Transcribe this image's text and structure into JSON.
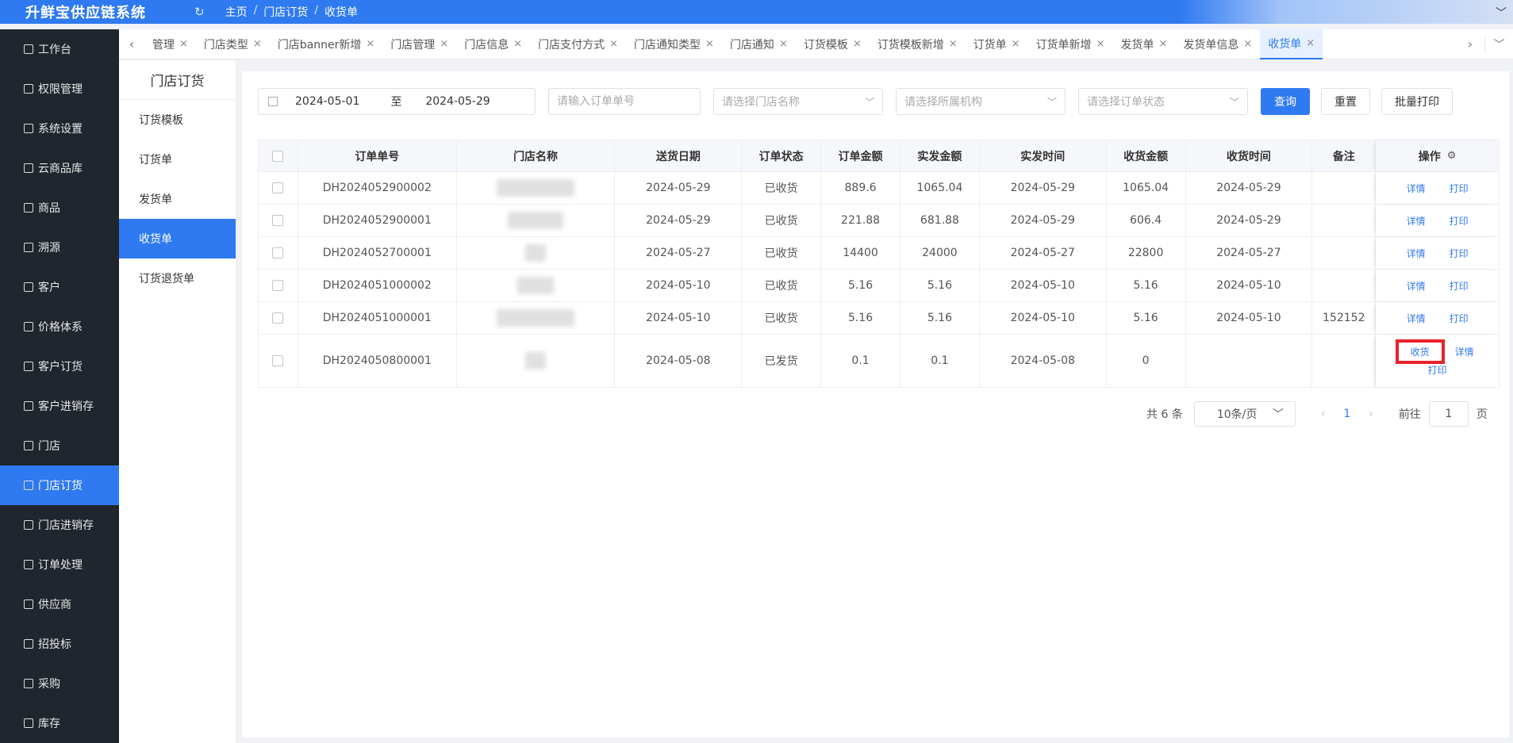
{
  "app": {
    "title": "升鲜宝供应链系统",
    "refresh_icon": "refresh-icon"
  },
  "breadcrumb": [
    "主页",
    "门店订货",
    "收货单"
  ],
  "sidebar": {
    "items": [
      {
        "label": "工作台",
        "icon": "monitor-icon"
      },
      {
        "label": "权限管理",
        "icon": "shield-icon"
      },
      {
        "label": "系统设置",
        "icon": "gear-icon"
      },
      {
        "label": "云商品库",
        "icon": "cloud-icon"
      },
      {
        "label": "商品",
        "icon": "box-icon"
      },
      {
        "label": "溯源",
        "icon": "trace-icon"
      },
      {
        "label": "客户",
        "icon": "user-icon"
      },
      {
        "label": "价格体系",
        "icon": "price-icon"
      },
      {
        "label": "客户订货",
        "icon": "doc-icon"
      },
      {
        "label": "客户进销存",
        "icon": "bank-icon"
      },
      {
        "label": "门店",
        "icon": "store-icon"
      },
      {
        "label": "门店订货",
        "icon": "user-icon",
        "active": true
      },
      {
        "label": "门店进销存",
        "icon": "inventory-icon"
      },
      {
        "label": "订单处理",
        "icon": "send-icon"
      },
      {
        "label": "供应商",
        "icon": "supplier-icon"
      },
      {
        "label": "招投标",
        "icon": "bid-icon"
      },
      {
        "label": "采购",
        "icon": "purchase-icon"
      },
      {
        "label": "库存",
        "icon": "stock-icon"
      }
    ]
  },
  "tabs": [
    {
      "label": "管理"
    },
    {
      "label": "门店类型"
    },
    {
      "label": "门店banner新增"
    },
    {
      "label": "门店管理"
    },
    {
      "label": "门店信息"
    },
    {
      "label": "门店支付方式"
    },
    {
      "label": "门店通知类型"
    },
    {
      "label": "门店通知"
    },
    {
      "label": "订货模板"
    },
    {
      "label": "订货模板新增"
    },
    {
      "label": "订货单"
    },
    {
      "label": "订货单新增"
    },
    {
      "label": "发货单"
    },
    {
      "label": "发货单信息"
    },
    {
      "label": "收货单",
      "active": true
    }
  ],
  "subnav": {
    "title": "门店订货",
    "items": [
      {
        "label": "订货模板"
      },
      {
        "label": "订货单"
      },
      {
        "label": "发货单"
      },
      {
        "label": "收货单",
        "active": true
      },
      {
        "label": "订货退货单"
      }
    ]
  },
  "filters": {
    "date_start": "2024-05-01",
    "date_to": "至",
    "date_end": "2024-05-29",
    "order_no_placeholder": "请输入订单单号",
    "store_placeholder": "请选择门店名称",
    "org_placeholder": "请选择所属机构",
    "status_placeholder": "请选择订单状态",
    "query_label": "查询",
    "reset_label": "重置",
    "batch_print_label": "批量打印"
  },
  "table": {
    "headers": [
      "订单单号",
      "门店名称",
      "送货日期",
      "订单状态",
      "订单金额",
      "实发金额",
      "实发时间",
      "收货金额",
      "收货时间",
      "备注",
      "操作"
    ],
    "rows": [
      {
        "order_no": "DH2024052900002",
        "store": "",
        "delivery_date": "2024-05-29",
        "status": "已收货",
        "amount": "889.6",
        "shipped_amount": "1065.04",
        "shipped_time": "2024-05-29",
        "received_amount": "1065.04",
        "received_time": "2024-05-29",
        "remark": "",
        "ops": [
          "详情",
          "打印"
        ]
      },
      {
        "order_no": "DH2024052900001",
        "store": "",
        "delivery_date": "2024-05-29",
        "status": "已收货",
        "amount": "221.88",
        "shipped_amount": "681.88",
        "shipped_time": "2024-05-29",
        "received_amount": "606.4",
        "received_time": "2024-05-29",
        "remark": "",
        "ops": [
          "详情",
          "打印"
        ]
      },
      {
        "order_no": "DH2024052700001",
        "store": "",
        "delivery_date": "2024-05-27",
        "status": "已收货",
        "amount": "14400",
        "shipped_amount": "24000",
        "shipped_time": "2024-05-27",
        "received_amount": "22800",
        "received_time": "2024-05-27",
        "remark": "",
        "ops": [
          "详情",
          "打印"
        ]
      },
      {
        "order_no": "DH2024051000002",
        "store": "",
        "delivery_date": "2024-05-10",
        "status": "已收货",
        "amount": "5.16",
        "shipped_amount": "5.16",
        "shipped_time": "2024-05-10",
        "received_amount": "5.16",
        "received_time": "2024-05-10",
        "remark": "",
        "ops": [
          "详情",
          "打印"
        ]
      },
      {
        "order_no": "DH2024051000001",
        "store": "",
        "delivery_date": "2024-05-10",
        "status": "已收货",
        "amount": "5.16",
        "shipped_amount": "5.16",
        "shipped_time": "2024-05-10",
        "received_amount": "5.16",
        "received_time": "2024-05-10",
        "remark": "152152",
        "ops": [
          "详情",
          "打印"
        ]
      },
      {
        "order_no": "DH2024050800001",
        "store": "",
        "delivery_date": "2024-05-08",
        "status": "已发货",
        "amount": "0.1",
        "shipped_amount": "0.1",
        "shipped_time": "2024-05-08",
        "received_amount": "0",
        "received_time": "",
        "remark": "",
        "ops": [
          "收货",
          "详情",
          "打印"
        ]
      }
    ]
  },
  "pagination": {
    "total_label": "共 6 条",
    "page_size": "10条/页",
    "current_page": "1",
    "goto_label": "前往",
    "goto_value": "1",
    "page_suffix": "页"
  },
  "colors": {
    "primary": "#2f7af0",
    "sidebar_bg": "#1f262d",
    "highlight": "#e8222a"
  }
}
